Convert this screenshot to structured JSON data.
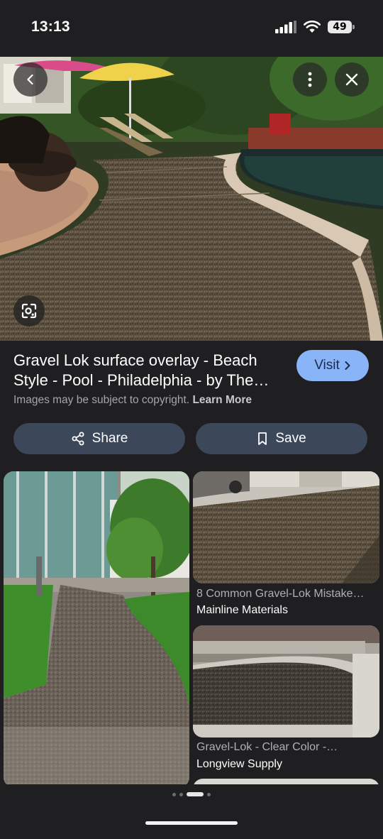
{
  "status_bar": {
    "time": "13:13",
    "battery": "49"
  },
  "result": {
    "title": "Gravel Lok surface overlay - Beach Style - Pool - Philadelphia - by The…",
    "copyright_text": "Images may be subject to copyright.",
    "learn_more": "Learn More",
    "visit_label": "Visit"
  },
  "actions": {
    "share_label": "Share",
    "save_label": "Save"
  },
  "related": [
    {
      "title": "8 Common Gravel-Lok Mistake…",
      "source": "Mainline Materials"
    },
    {
      "title": "Gravel-Lok - Clear Color -…",
      "source": "Longview Supply"
    }
  ],
  "icons": {
    "back": "chevron-left-icon",
    "more": "more-vert-icon",
    "close": "close-icon",
    "lens": "google-lens-icon",
    "share": "share-icon",
    "save": "bookmark-icon"
  },
  "colors": {
    "accent": "#8ab4f8",
    "pill": "#3c4759",
    "background": "#1f1f21"
  }
}
